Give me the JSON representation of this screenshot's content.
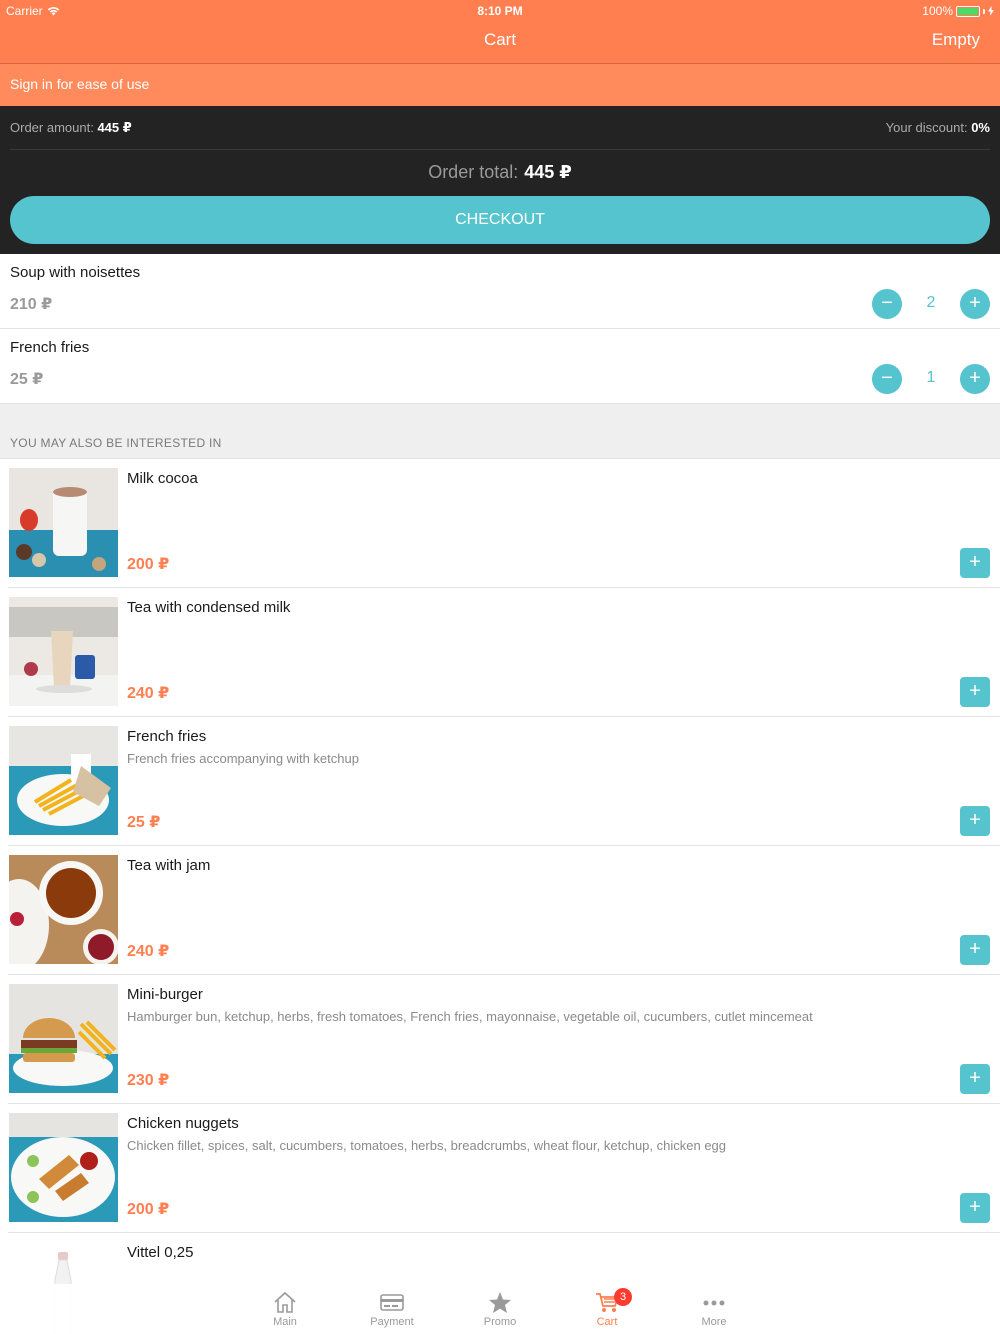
{
  "status": {
    "carrier": "Carrier",
    "time": "8:10 PM",
    "battery": "100%"
  },
  "nav": {
    "title": "Cart",
    "right_action": "Empty"
  },
  "signin_banner": "Sign in for ease of use",
  "summary": {
    "order_amount_label": "Order amount:",
    "order_amount_value": "445 ₽",
    "discount_label": "Your discount:",
    "discount_value": "0%",
    "total_label": "Order total:",
    "total_value": "445 ₽",
    "checkout_label": "CHECKOUT"
  },
  "cart": [
    {
      "name": "Soup with noisettes",
      "price": "210 ₽",
      "qty": "2"
    },
    {
      "name": "French fries",
      "price": "25 ₽",
      "qty": "1"
    }
  ],
  "suggestions_title": "YOU MAY ALSO BE INTERESTED IN",
  "suggestions": [
    {
      "name": "Milk cocoa",
      "desc": "",
      "price": "200 ₽"
    },
    {
      "name": "Tea with condensed milk",
      "desc": "",
      "price": "240 ₽"
    },
    {
      "name": "French fries",
      "desc": "French fries accompanying with ketchup",
      "price": "25 ₽"
    },
    {
      "name": "Tea with jam",
      "desc": "",
      "price": "240 ₽"
    },
    {
      "name": "Mini-burger",
      "desc": "Hamburger bun, ketchup, herbs, fresh tomatoes, French fries, mayonnaise, vegetable oil, cucumbers, cutlet mincemeat",
      "price": "230 ₽"
    },
    {
      "name": "Chicken nuggets",
      "desc": "Chicken fillet, spices, salt, cucumbers, tomatoes, herbs, breadcrumbs, wheat flour, ketchup, chicken egg",
      "price": "200 ₽"
    },
    {
      "name": "Vittel 0,25",
      "desc": "",
      "price": ""
    }
  ],
  "tabs": [
    {
      "label": "Main",
      "icon": "home-icon"
    },
    {
      "label": "Payment",
      "icon": "card-icon"
    },
    {
      "label": "Promo",
      "icon": "star-icon"
    },
    {
      "label": "Cart",
      "icon": "cart-icon",
      "badge": "3",
      "active": true
    },
    {
      "label": "More",
      "icon": "more-icon"
    }
  ],
  "colors": {
    "accent": "#ff7f50",
    "teal": "#55c4ce",
    "dark": "#232323"
  }
}
